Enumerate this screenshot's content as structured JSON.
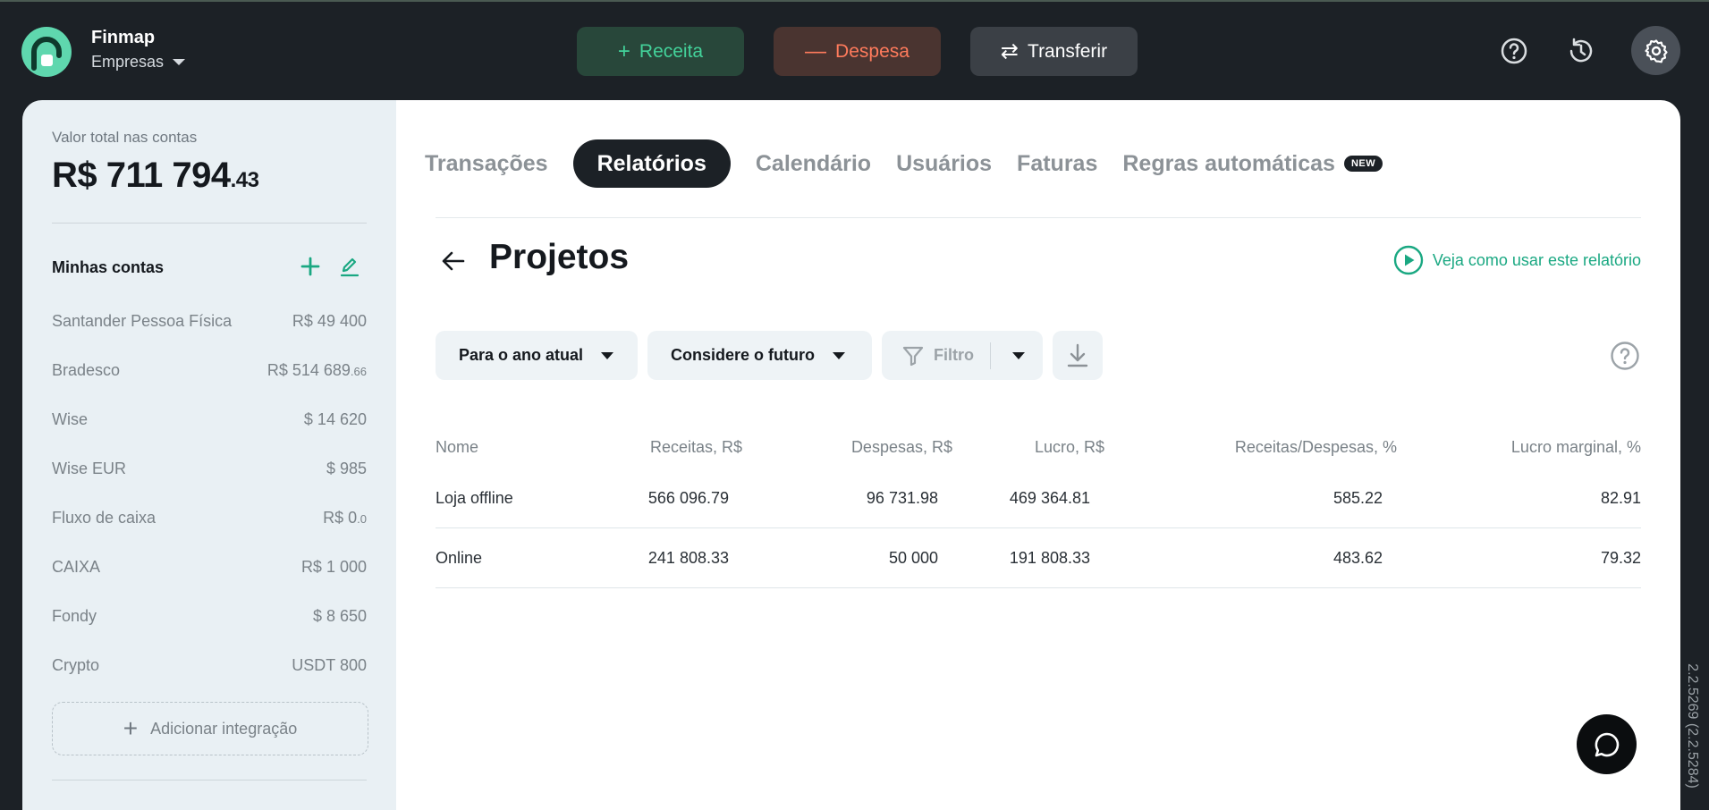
{
  "app": {
    "name": "Finmap",
    "workspace": "Empresas"
  },
  "actions": {
    "income": "Receita",
    "expense": "Despesa",
    "transfer": "Transferir"
  },
  "sidebar": {
    "total_label": "Valor total nas contas",
    "total_main": "R$ 711 794",
    "total_cents": ".43",
    "accounts_title": "Minhas contas",
    "accounts": [
      {
        "name": "Santander Pessoa Física",
        "amount": "R$ 49 400",
        "cents": ""
      },
      {
        "name": "Bradesco",
        "amount": "R$ 514 689",
        "cents": ".66"
      },
      {
        "name": "Wise",
        "amount": "$  14 620",
        "cents": ""
      },
      {
        "name": "Wise EUR",
        "amount": "$  985",
        "cents": ""
      },
      {
        "name": "Fluxo de caixa",
        "amount": "R$ 0",
        "cents": ".0"
      },
      {
        "name": "CAIXA",
        "amount": "R$ 1 000",
        "cents": ""
      },
      {
        "name": "Fondy",
        "amount": "$  8 650",
        "cents": ""
      },
      {
        "name": "Crypto",
        "amount": "USDT 800",
        "cents": ""
      }
    ],
    "add_integration": "Adicionar integração"
  },
  "tabs": [
    {
      "label": "Transações",
      "active": false
    },
    {
      "label": "Relatórios",
      "active": true
    },
    {
      "label": "Calendário",
      "active": false
    },
    {
      "label": "Usuários",
      "active": false
    },
    {
      "label": "Faturas",
      "active": false
    },
    {
      "label": "Regras automáticas",
      "active": false,
      "badge": "NEW"
    }
  ],
  "report": {
    "title": "Projetos",
    "howto": "Veja como usar este relatório",
    "period": "Para o ano atual",
    "future": "Considere o futuro",
    "filter": "Filtro"
  },
  "table": {
    "headers": [
      "Nome",
      "Receitas, R$",
      "Despesas, R$",
      "Lucro, R$",
      "Receitas/Despesas, %",
      "Lucro marginal, %"
    ],
    "rows": [
      [
        "Loja offline",
        "566 096.79",
        "96 731.98",
        "469 364.81",
        "585.22",
        "82.91"
      ],
      [
        "Online",
        "241 808.33",
        "50 000",
        "191 808.33",
        "483.62",
        "79.32"
      ]
    ]
  },
  "version": "2.2.5269 (2.2.5284)",
  "colors": {
    "accent_green": "#1aa882",
    "income": "#43d29a",
    "expense": "#ff7b5c",
    "dark": "#1c2126"
  }
}
